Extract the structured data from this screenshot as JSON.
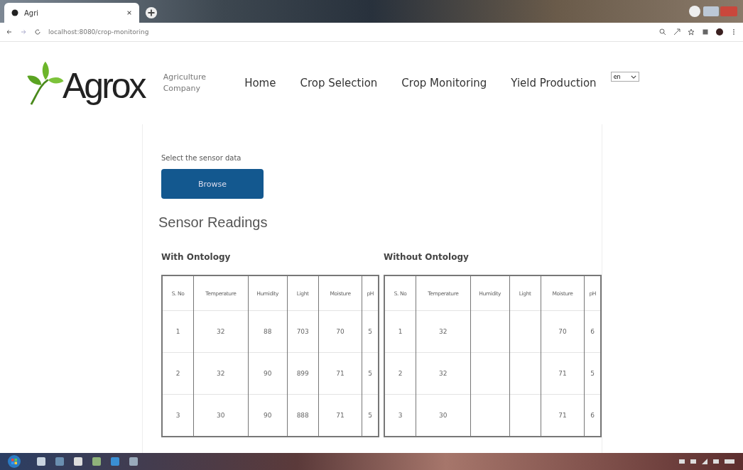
{
  "browser": {
    "tab_title": "Agri",
    "url": "localhost:8080/crop-monitoring"
  },
  "header": {
    "logo": "Agrox",
    "tagline": [
      "Agriculture",
      "Company"
    ],
    "nav": [
      {
        "label": "Home",
        "selected": false
      },
      {
        "label": "Crop Selection",
        "selected": false
      },
      {
        "label": "Crop Monitoring",
        "selected": false
      },
      {
        "label": "Yield Production",
        "selected": false
      }
    ],
    "language": "en"
  },
  "upload": {
    "label": "Select the sensor data",
    "button": "Browse"
  },
  "title": "Sensor Readings",
  "tables": [
    {
      "title": "With Ontology",
      "columns": [
        "S. No",
        "Temperature",
        "Humidity",
        "Light",
        "Moisture",
        "pH"
      ],
      "rows": [
        [
          "1",
          "32",
          "88",
          "703",
          "70",
          "5"
        ],
        [
          "2",
          "32",
          "90",
          "899",
          "71",
          "5"
        ],
        [
          "3",
          "30",
          "90",
          "888",
          "71",
          "5"
        ]
      ]
    },
    {
      "title": "Without Ontology",
      "columns": [
        "S. No",
        "Temperature",
        "Humidity",
        "Light",
        "Moisture",
        "pH"
      ],
      "rows": [
        [
          "1",
          "32",
          "",
          "",
          "70",
          "6"
        ],
        [
          "2",
          "32",
          "",
          "",
          "71",
          "5"
        ],
        [
          "3",
          "30",
          "",
          "",
          "71",
          "6"
        ]
      ]
    }
  ]
}
